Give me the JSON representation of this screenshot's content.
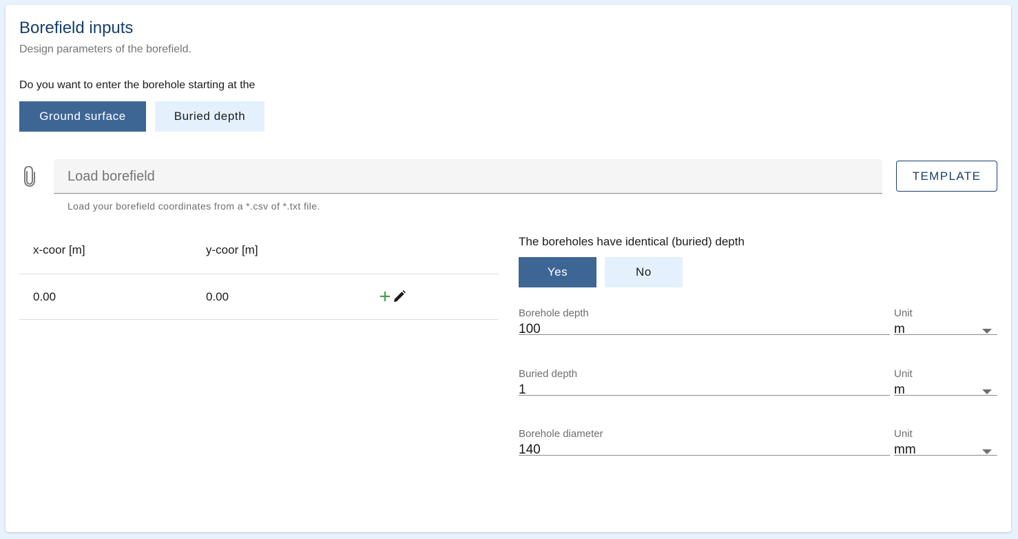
{
  "header": {
    "title": "Borefield inputs",
    "subtitle": "Design parameters of the borefield."
  },
  "start_question": {
    "label": "Do you want to enter the borehole starting at the",
    "options": [
      "Ground surface",
      "Buried depth"
    ],
    "selected": "Ground surface"
  },
  "file_input": {
    "placeholder": "Load borefield",
    "hint": "Load your borefield coordinates from a *.csv of *.txt file.",
    "icon": "paperclip-icon"
  },
  "template_button": {
    "label": "TEMPLATE"
  },
  "table": {
    "columns": [
      "x-coor [m]",
      "y-coor [m]"
    ],
    "rows": [
      {
        "x": "0.00",
        "y": "0.00"
      }
    ],
    "row_action_icons": [
      "plus-icon",
      "pencil-icon"
    ]
  },
  "identical_depth": {
    "label": "The boreholes have identical (buried) depth",
    "options": [
      "Yes",
      "No"
    ],
    "selected": "Yes"
  },
  "fields": [
    {
      "label": "Borehole depth",
      "value": "100",
      "unit_label": "Unit",
      "unit": "m"
    },
    {
      "label": "Buried depth",
      "value": "1",
      "unit_label": "Unit",
      "unit": "m"
    },
    {
      "label": "Borehole diameter",
      "value": "140",
      "unit_label": "Unit",
      "unit": "mm"
    }
  ],
  "colors": {
    "primary": "#3d6695",
    "title": "#173f6b",
    "inactive_toggle": "#e4f1fd",
    "add_icon": "#43a047",
    "background": "#e8f2fc"
  }
}
